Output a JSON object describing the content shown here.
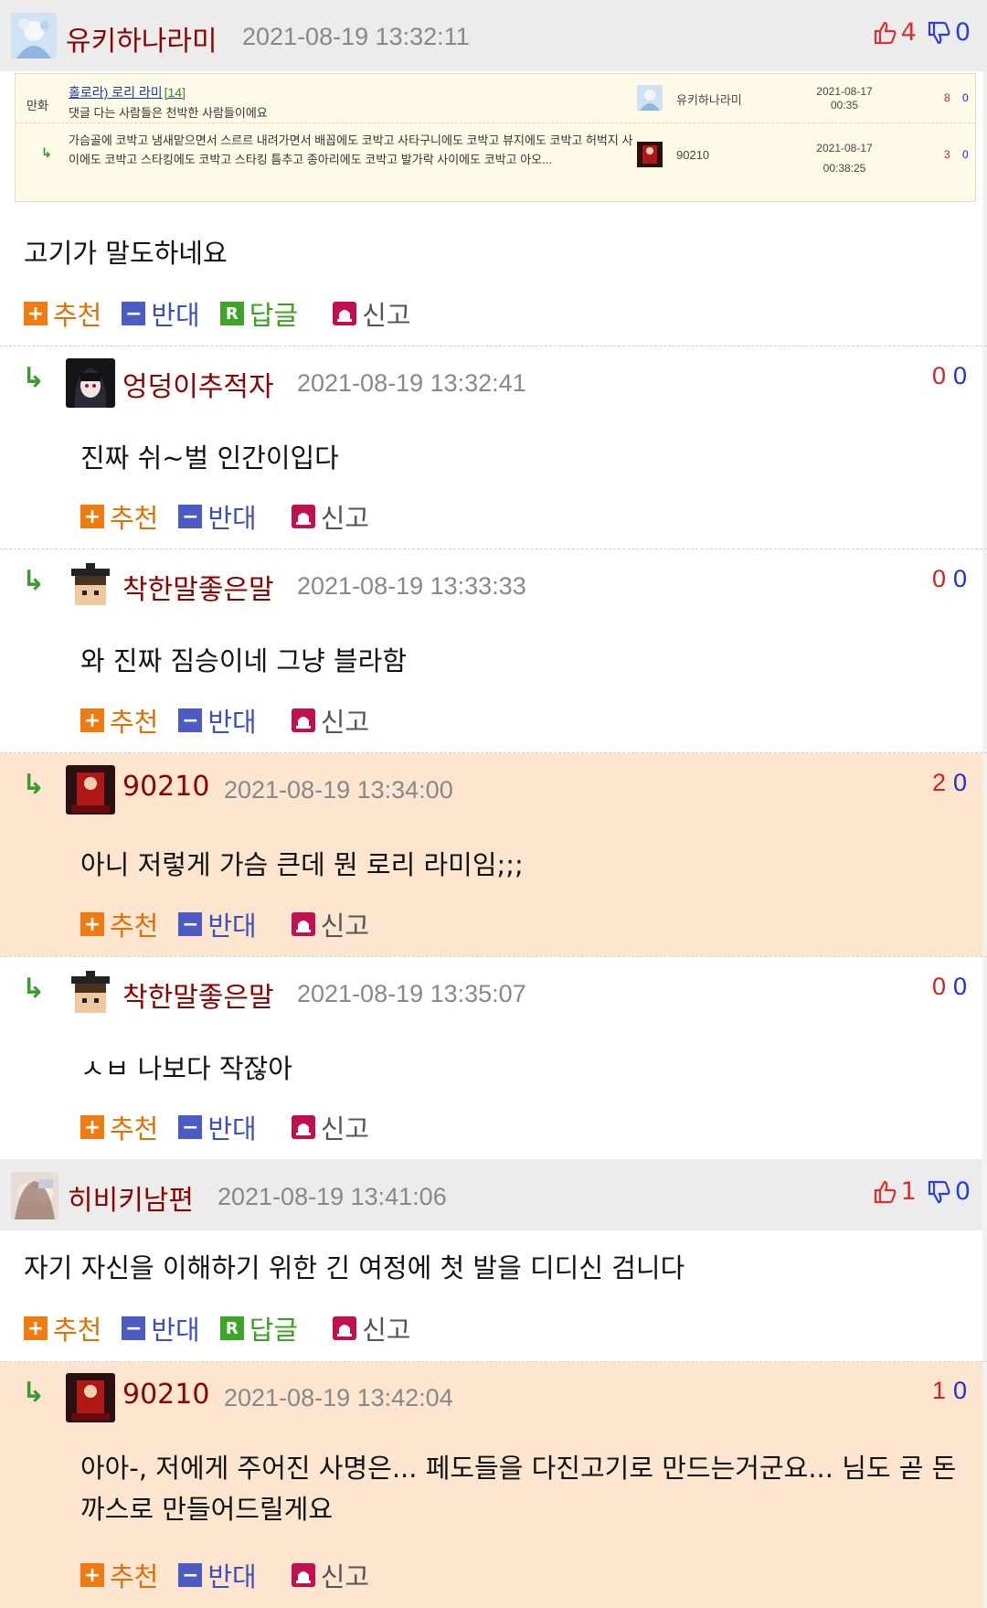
{
  "top_comment": {
    "username": "유키하나라미",
    "timestamp": "2021-08-19 13:32:11",
    "up": "4",
    "down": "0",
    "text": "고기가 말도하네요"
  },
  "preview": {
    "category": "만화",
    "title": "홀로라) 로리 라미",
    "title_count": "[14]",
    "subtitle": "댓글 다는 사람들은 천박한 사람들이에요",
    "author1": "유키하나라미",
    "date1": "2021-08-17",
    "time1": "00:35",
    "up1": "8",
    "down1": "0",
    "reply_text": "가슴골에 코박고 냄새맡으면서 스르르 내려가면서 배꼽에도 코박고 사타구니에도 코박고 뷰지에도 코박고 허벅지 사이에도 코박고 스타킹에도 코박고 스타킹 틈추고 종아리에도 코박고 발가락 사이에도 코박고 아오...",
    "author2": "90210",
    "date2": "2021-08-17",
    "time2": "00:38:25",
    "up2": "3",
    "down2": "0"
  },
  "actions": {
    "recommend": "추천",
    "oppose": "반대",
    "reply": "답글",
    "report": "신고",
    "plus_glyph": "+",
    "minus_glyph": "−",
    "reply_glyph": "R"
  },
  "replies": [
    {
      "username": "엉덩이추적자",
      "timestamp": "2021-08-19 13:32:41",
      "up": "0",
      "down": "0",
      "text": "진짜 쉬~벌 인간이입다"
    },
    {
      "username": "착한말좋은말",
      "timestamp": "2021-08-19 13:33:33",
      "up": "0",
      "down": "0",
      "text": "와 진짜 짐승이네 그냥 블라함"
    },
    {
      "username": "90210",
      "timestamp": "2021-08-19 13:34:00",
      "up": "2",
      "down": "0",
      "text": "아니 저렇게 가슴 큰데 뭔 로리 라미임;;;"
    },
    {
      "username": "착한말좋은말",
      "timestamp": "2021-08-19 13:35:07",
      "up": "0",
      "down": "0",
      "text": "ㅅㅂ 나보다 작잖아"
    }
  ],
  "second_comment": {
    "username": "히비키남편",
    "timestamp": "2021-08-19 13:41:06",
    "up": "1",
    "down": "0",
    "text": "자기 자신을 이해하기 위한 긴 여정에 첫 발을 디디신 검니다"
  },
  "last_reply": {
    "username": "90210",
    "timestamp": "2021-08-19 13:42:04",
    "up": "1",
    "down": "0",
    "text": "아아-, 저에게 주어진 사명은... 페도들을 다진고기로 만드는거군요... 님도 곧 돈까스로 만들어드릴게요"
  },
  "icons": {
    "thumb_up": "thumbs-up-icon",
    "thumb_down": "thumbs-down-icon",
    "reply_arrow": "reply-arrow-icon",
    "report": "siren-icon"
  },
  "colors": {
    "username": "#8b0000",
    "recommend": "#f07b10",
    "oppose": "#4c5cc4",
    "reply": "#3ea52a",
    "report": "#c01050",
    "reply_bg": "#fde5d0",
    "header_bg": "#ececec"
  }
}
